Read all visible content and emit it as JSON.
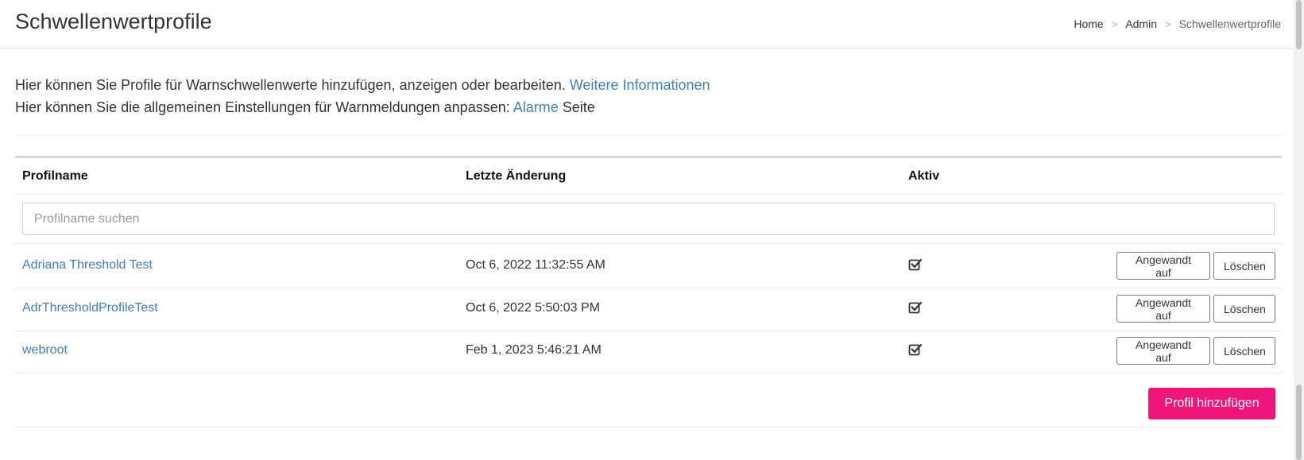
{
  "header": {
    "title": "Schwellenwertprofile",
    "breadcrumb": [
      {
        "label": "Home"
      },
      {
        "label": "Admin"
      },
      {
        "label": "Schwellenwertprofile"
      }
    ],
    "breadcrumb_sep": ">"
  },
  "intro": {
    "line1_text": "Hier können Sie Profile für Warnschwellenwerte hinzufügen, anzeigen oder bearbeiten.",
    "line1_link": "Weitere Informationen",
    "line2_text": "Hier können Sie die allgemeinen Einstellungen für Warnmeldungen anpassen:",
    "line2_link": "Alarme",
    "line2_suffix": "Seite"
  },
  "table": {
    "headers": {
      "name": "Profilname",
      "changed": "Letzte Änderung",
      "active": "Aktiv"
    },
    "search_placeholder": "Profilname suchen",
    "rows": [
      {
        "name": "Adriana Threshold Test",
        "changed": "Oct 6, 2022 11:32:55 AM",
        "active": true
      },
      {
        "name": "AdrThresholdProfileTest",
        "changed": "Oct 6, 2022 5:50:03 PM",
        "active": true
      },
      {
        "name": "webroot",
        "changed": "Feb 1, 2023 5:46:21 AM",
        "active": true
      }
    ],
    "applied_label": "Angewandt auf",
    "delete_label": "Löschen"
  },
  "add_button_label": "Profil hinzufügen",
  "colors": {
    "link": "#3f7fb5",
    "primary": "#f0157a"
  },
  "icons": {
    "active": "checkbox-checked-icon"
  }
}
